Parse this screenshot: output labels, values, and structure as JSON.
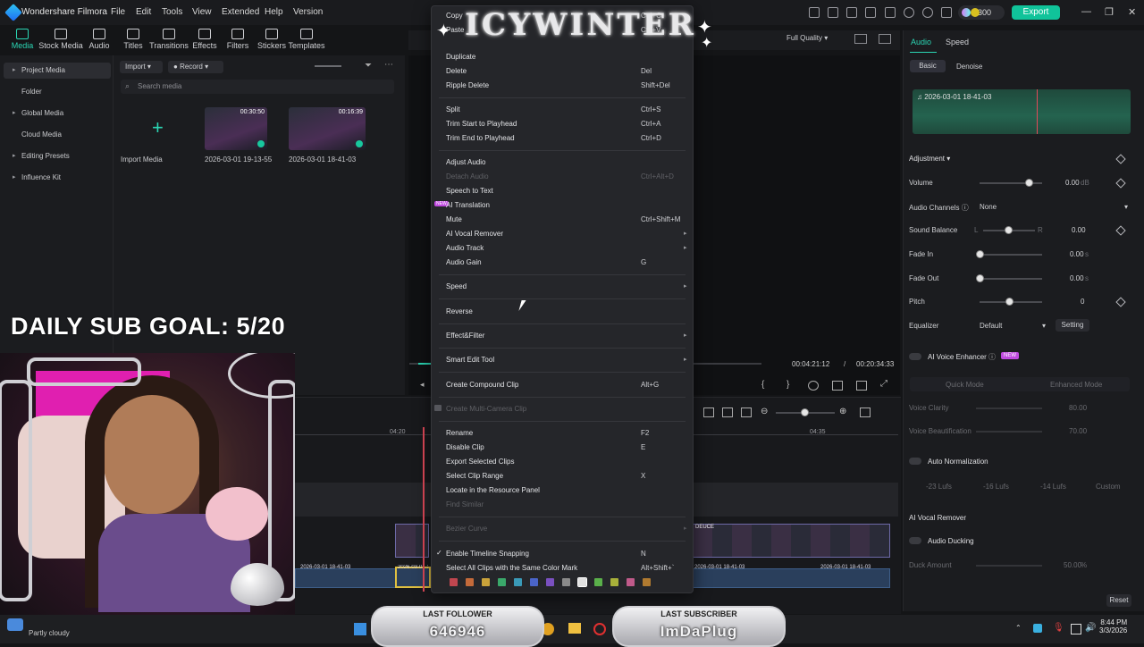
{
  "titlebar": {
    "app_name": "Wondershare Filmora",
    "menus": [
      "File",
      "Edit",
      "Tools",
      "View",
      "Extended",
      "Help",
      "Version"
    ],
    "credits": "300",
    "export_label": "Export"
  },
  "toolbar": {
    "items": [
      "Media",
      "Stock Media",
      "Audio",
      "Titles",
      "Transitions",
      "Effects",
      "Filters",
      "Stickers",
      "Templates"
    ]
  },
  "sidebar": {
    "items": [
      "Project Media",
      "Folder",
      "Global Media",
      "Cloud Media",
      "Editing Presets",
      "Influence Kit"
    ]
  },
  "media": {
    "import_label": "Import",
    "record_label": "Record",
    "search_placeholder": "Search media",
    "import_media_label": "Import Media",
    "clips": [
      {
        "name": "2026-03-01 19-13-55",
        "duration": "00:30:50"
      },
      {
        "name": "2026-03-01 18-41-03",
        "duration": "00:16:39"
      }
    ]
  },
  "preview": {
    "quality": "Full Quality",
    "current_time": "00:04:21:12",
    "separator": "/",
    "total_time": "00:20:34:33"
  },
  "timeline": {
    "ruler_marks": [
      "04:20",
      "04:35"
    ],
    "clip_label_deuce": "DEUCE",
    "audio_labels": [
      "2026-03-01 18-41-03",
      "2026-03-01 18-41-03",
      "2026-03-01 18-41-03",
      "2026-03-01 18-41-03"
    ]
  },
  "right_panel": {
    "tabs": [
      "Audio",
      "Speed"
    ],
    "subtabs": [
      "Basic",
      "Denoise"
    ],
    "audio_file": "2026-03-01 18-41-03",
    "adjustment_title": "Adjustment",
    "volume_label": "Volume",
    "volume_value": "0.00",
    "volume_unit": "dB",
    "audio_channels_label": "Audio Channels",
    "audio_channels_value": "None",
    "sound_balance_label": "Sound Balance",
    "sound_balance_l": "L",
    "sound_balance_r": "R",
    "sound_balance_value": "0.00",
    "fade_in_label": "Fade In",
    "fade_in_value": "0.00",
    "fade_in_unit": "s",
    "fade_out_label": "Fade Out",
    "fade_out_value": "0.00",
    "fade_out_unit": "s",
    "pitch_label": "Pitch",
    "pitch_value": "0",
    "equalizer_label": "Equalizer",
    "equalizer_value": "Default",
    "setting_label": "Setting",
    "ai_voice_enhancer_label": "AI Voice Enhancer",
    "new_badge": "NEW",
    "quick_mode": "Quick Mode",
    "enhanced_mode": "Enhanced Mode",
    "voice_clarity_label": "Voice Clarity",
    "voice_clarity_value": "80.00",
    "voice_beautification_label": "Voice Beautification",
    "voice_beautification_value": "70.00",
    "auto_normalization_label": "Auto Normalization",
    "lufs_presets": [
      "-23 Lufs",
      "-16 Lufs",
      "-14 Lufs",
      "Custom"
    ],
    "ai_vocal_remover_label": "AI Vocal Remover",
    "audio_ducking_label": "Audio Ducking",
    "duck_amount_label": "Duck Amount",
    "duck_amount_value": "50.00",
    "duck_amount_unit": "%",
    "reset_label": "Reset"
  },
  "context_menu": {
    "items": [
      {
        "label": "Copy",
        "shortcut": "Ctrl+C",
        "disabled": false
      },
      {
        "label": "Paste",
        "shortcut": "Ctrl+V",
        "disabled": false
      },
      {
        "label": "Duplicate",
        "shortcut": "",
        "disabled": false
      },
      {
        "label": "Delete",
        "shortcut": "Del",
        "disabled": false
      },
      {
        "label": "Ripple Delete",
        "shortcut": "Shift+Del",
        "disabled": false
      },
      {
        "label": "Split",
        "shortcut": "Ctrl+S",
        "disabled": false
      },
      {
        "label": "Trim Start to Playhead",
        "shortcut": "Ctrl+A",
        "disabled": false
      },
      {
        "label": "Trim End to Playhead",
        "shortcut": "Ctrl+D",
        "disabled": false
      },
      {
        "label": "Adjust Audio",
        "shortcut": "",
        "disabled": false
      },
      {
        "label": "Detach Audio",
        "shortcut": "Ctrl+Alt+D",
        "disabled": true
      },
      {
        "label": "Speech to Text",
        "shortcut": "",
        "disabled": false
      },
      {
        "label": "AI Translation",
        "shortcut": "",
        "disabled": false
      },
      {
        "label": "Mute",
        "shortcut": "Ctrl+Shift+M",
        "disabled": false
      },
      {
        "label": "AI Vocal Remover",
        "shortcut": "",
        "disabled": false,
        "submenu": true
      },
      {
        "label": "Audio Track",
        "shortcut": "",
        "disabled": false,
        "submenu": true
      },
      {
        "label": "Audio Gain",
        "shortcut": "G",
        "disabled": false
      },
      {
        "label": "Speed",
        "shortcut": "",
        "disabled": false,
        "submenu": true
      },
      {
        "label": "Reverse",
        "shortcut": "",
        "disabled": false
      },
      {
        "label": "Effect&Filter",
        "shortcut": "",
        "disabled": false,
        "submenu": true
      },
      {
        "label": "Smart Edit Tool",
        "shortcut": "",
        "disabled": false,
        "submenu": true
      },
      {
        "label": "Create Compound Clip",
        "shortcut": "Alt+G",
        "disabled": false
      },
      {
        "label": "Create Multi-Camera Clip",
        "shortcut": "",
        "disabled": true
      },
      {
        "label": "Rename",
        "shortcut": "F2",
        "disabled": false
      },
      {
        "label": "Disable Clip",
        "shortcut": "E",
        "disabled": false
      },
      {
        "label": "Export Selected Clips",
        "shortcut": "",
        "disabled": false
      },
      {
        "label": "Select Clip Range",
        "shortcut": "X",
        "disabled": false
      },
      {
        "label": "Locate in the Resource Panel",
        "shortcut": "",
        "disabled": false
      },
      {
        "label": "Find Similar",
        "shortcut": "",
        "disabled": true
      },
      {
        "label": "Bezier Curve",
        "shortcut": "",
        "disabled": true,
        "submenu": true
      },
      {
        "label": "Enable Timeline Snapping",
        "shortcut": "N",
        "disabled": false,
        "checked": true
      },
      {
        "label": "Select All Clips with the Same Color Mark",
        "shortcut": "Alt+Shift+`",
        "disabled": false
      }
    ],
    "color_marks": [
      "#c0464f",
      "#c46a3a",
      "#c9a23a",
      "#3aa86a",
      "#3a9ab8",
      "#4a64c8",
      "#7a50c0",
      "#8a8a8a",
      "#e0e0e0",
      "#5ab04a",
      "#a8b03a",
      "#c05a8a",
      "#b07a30"
    ]
  },
  "stream_overlay": {
    "logo_text": "ICYWINTER",
    "sub_goal": "DAILY SUB GOAL: 5/20",
    "last_follower_title": "LAST FOLLOWER",
    "last_follower_value": "646946",
    "last_subscriber_title": "LAST SUBSCRIBER",
    "last_subscriber_value": "ImDaPlug"
  },
  "taskbar": {
    "weather": "Partly cloudy",
    "time": "8:44 PM",
    "date": "3/3/2026"
  }
}
